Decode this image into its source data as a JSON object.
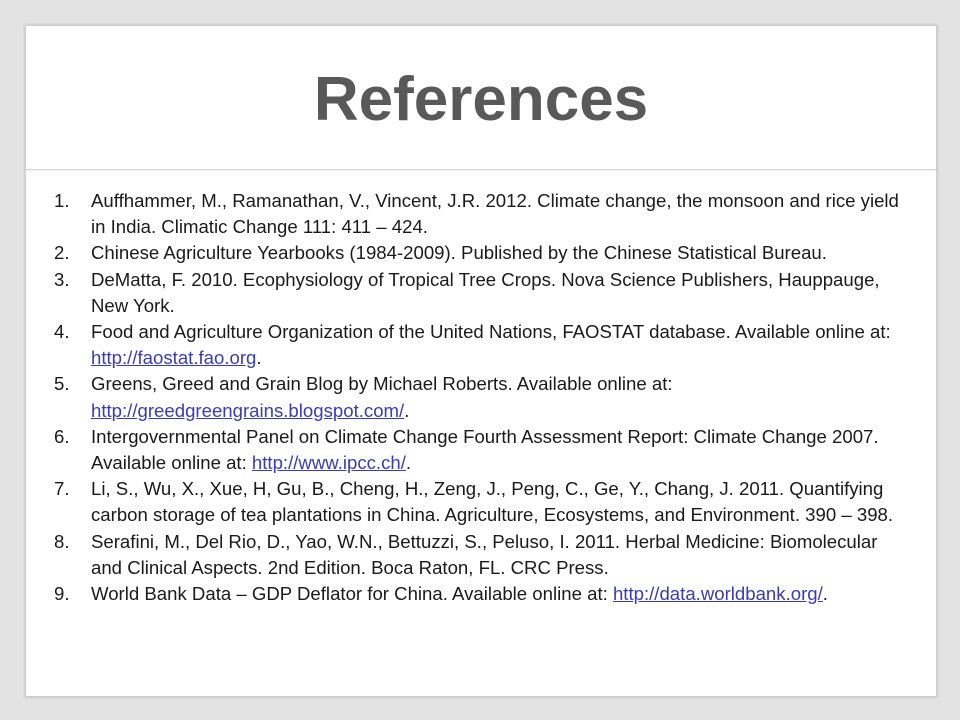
{
  "slide": {
    "title": "References"
  },
  "references": [
    {
      "number": "1.",
      "text": "Auffhammer, M., Ramanathan, V., Vincent, J.R. 2012. Climate change, the monsoon and rice yield in India. Climatic Change 111: 411 – 424.",
      "link": "",
      "suffix": ""
    },
    {
      "number": "2.",
      "text": "Chinese Agriculture Yearbooks (1984-2009). Published by the Chinese Statistical Bureau.",
      "link": "",
      "suffix": ""
    },
    {
      "number": "3.",
      "text": "DeMatta, F. 2010. Ecophysiology of Tropical Tree Crops. Nova Science Publishers, Hauppauge, New York.",
      "link": "",
      "suffix": ""
    },
    {
      "number": "4.",
      "text": "Food and Agriculture Organization of the United Nations, FAOSTAT database. Available online at: ",
      "link": "http://faostat.fao.org",
      "suffix": "."
    },
    {
      "number": "5.",
      "text": "Greens, Greed and Grain Blog by Michael Roberts. Available online at: ",
      "link": "http://greedgreengrains.blogspot.com/",
      "suffix": "."
    },
    {
      "number": "6.",
      "text": "Intergovernmental Panel on Climate Change Fourth Assessment Report: Climate Change 2007. Available online at: ",
      "link": "http://www.ipcc.ch/",
      "suffix": "."
    },
    {
      "number": "7.",
      "text": "Li, S., Wu, X., Xue, H, Gu, B., Cheng, H., Zeng, J., Peng, C., Ge, Y., Chang, J. 2011. Quantifying carbon storage of tea plantations in China. Agriculture, Ecosystems, and Environment. 390 – 398.",
      "link": "",
      "suffix": ""
    },
    {
      "number": "8.",
      "text": "Serafini, M., Del Rio, D., Yao, W.N., Bettuzzi, S., Peluso, I. 2011. Herbal Medicine: Biomolecular and Clinical Aspects. 2nd Edition. Boca Raton, FL. CRC Press.",
      "link": "",
      "suffix": ""
    },
    {
      "number": "9.",
      "text": "World Bank Data – GDP Deflator for China. Available online at: ",
      "link": "http://data.worldbank.org/",
      "suffix": "."
    }
  ],
  "colors": {
    "title": "#595959",
    "body_text": "#1a1a1a",
    "link": "#3b3bb3",
    "background": "#e3e3e3"
  }
}
